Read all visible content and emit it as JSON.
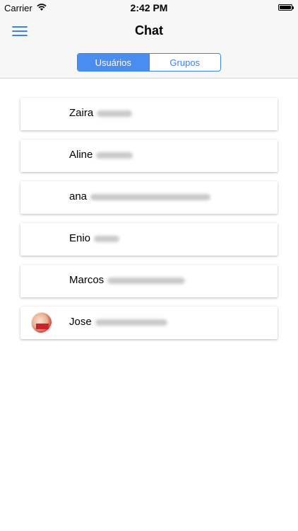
{
  "status_bar": {
    "carrier": "Carrier",
    "time": "2:42 PM",
    "battery_level_percent": 100
  },
  "nav": {
    "title": "Chat",
    "menu_icon": "hamburger-menu-icon"
  },
  "segments": {
    "items": [
      "Usuários",
      "Grupos"
    ],
    "selected": "Usuários"
  },
  "users": [
    {
      "first_name": "Zaira",
      "surname_blurred": true,
      "has_photo": false
    },
    {
      "first_name": "Aline",
      "surname_blurred": true,
      "has_photo": false
    },
    {
      "first_name": "ana",
      "surname_blurred": true,
      "has_photo": false
    },
    {
      "first_name": "Enio",
      "surname_blurred": true,
      "has_photo": false
    },
    {
      "first_name": "Marcos",
      "surname_blurred": true,
      "has_photo": false
    },
    {
      "first_name": "Jose",
      "surname_blurred": true,
      "has_photo": true
    }
  ],
  "colors": {
    "accent": "#3d82e7",
    "segment_active": "#4a8df0",
    "bar_background": "#f7f7f7"
  }
}
